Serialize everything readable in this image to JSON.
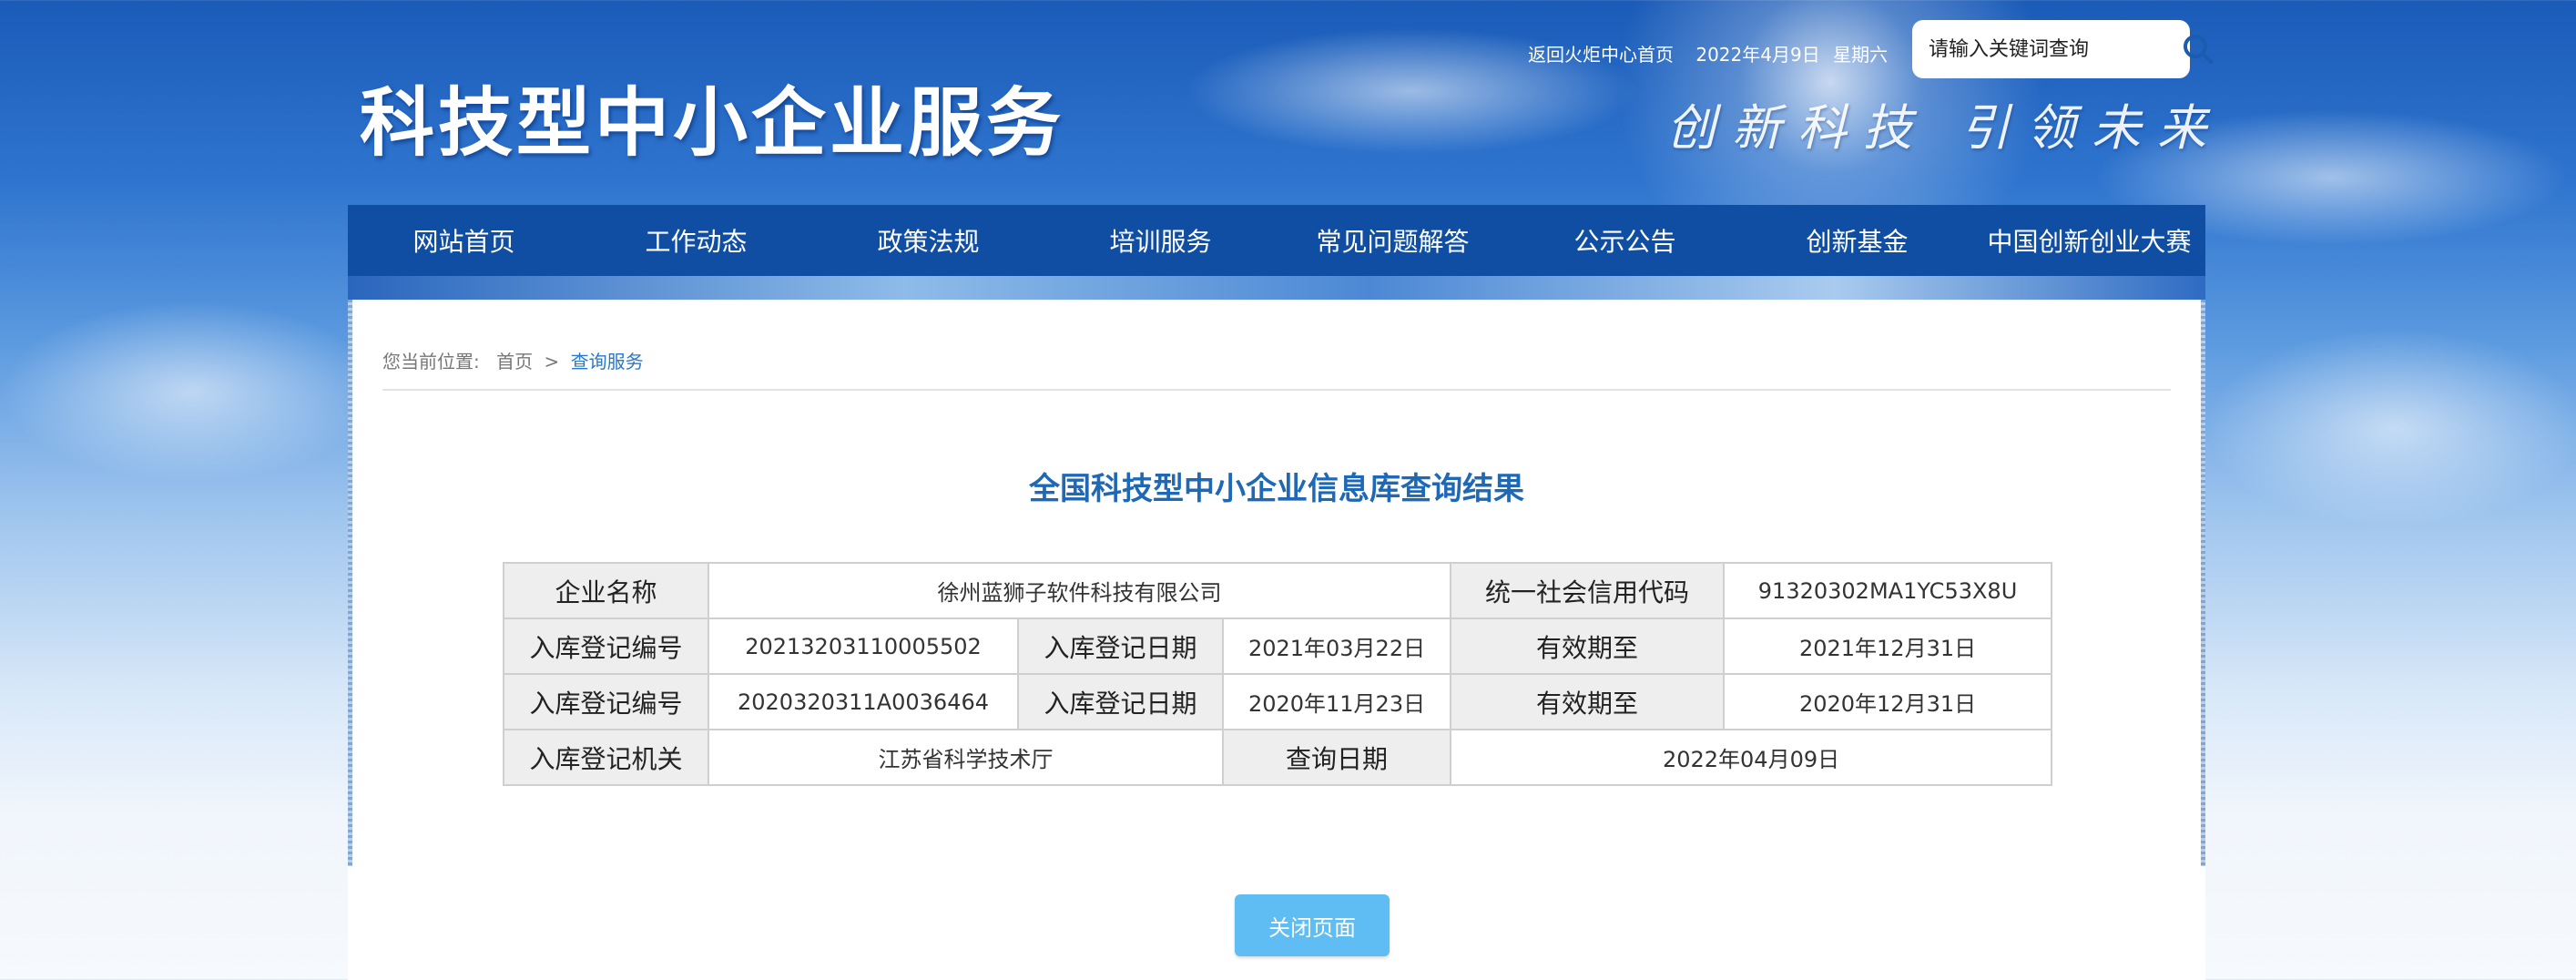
{
  "header": {
    "site_title": "科技型中小企业服务",
    "slogan": "创新科技 引领未来",
    "home_link": "返回火炬中心首页",
    "date": "2022年4月9日",
    "weekday": "星期六",
    "search": {
      "placeholder": "请输入关键词查询",
      "icon": "search-icon"
    }
  },
  "nav": {
    "items": [
      {
        "label": "网站首页"
      },
      {
        "label": "工作动态"
      },
      {
        "label": "政策法规"
      },
      {
        "label": "培训服务"
      },
      {
        "label": "常见问题解答"
      },
      {
        "label": "公示公告"
      },
      {
        "label": "创新基金"
      },
      {
        "label": "中国创新创业大赛"
      }
    ]
  },
  "breadcrumb": {
    "prefix": "您当前位置:",
    "home": "首页",
    "separator": ">",
    "current": "查询服务"
  },
  "result": {
    "title": "全国科技型中小企业信息库查询结果",
    "row1": {
      "company_label": "企业名称",
      "company_value": "徐州蓝狮子软件科技有限公司",
      "credit_label": "统一社会信用代码",
      "credit_value": "91320302MA1YC53X8U"
    },
    "row2": {
      "reg_no_label": "入库登记编号",
      "reg_no_value": "20213203110005502",
      "reg_date_label": "入库登记日期",
      "reg_date_value": "2021年03月22日",
      "valid_label": "有效期至",
      "valid_value": "2021年12月31日"
    },
    "row3": {
      "reg_no_label": "入库登记编号",
      "reg_no_value": "2020320311A0036464",
      "reg_date_label": "入库登记日期",
      "reg_date_value": "2020年11月23日",
      "valid_label": "有效期至",
      "valid_value": "2020年12月31日"
    },
    "row4": {
      "authority_label": "入库登记机关",
      "authority_value": "江苏省科学技术厅",
      "query_date_label": "查询日期",
      "query_date_value": "2022年04月09日"
    }
  },
  "actions": {
    "close_label": "关闭页面"
  },
  "colors": {
    "nav_bg": "#0f4ea3",
    "title_blue": "#1f68b6",
    "link_blue": "#2878c9",
    "button_bg": "#5fbdf3",
    "label_bg": "#eeeeee"
  }
}
